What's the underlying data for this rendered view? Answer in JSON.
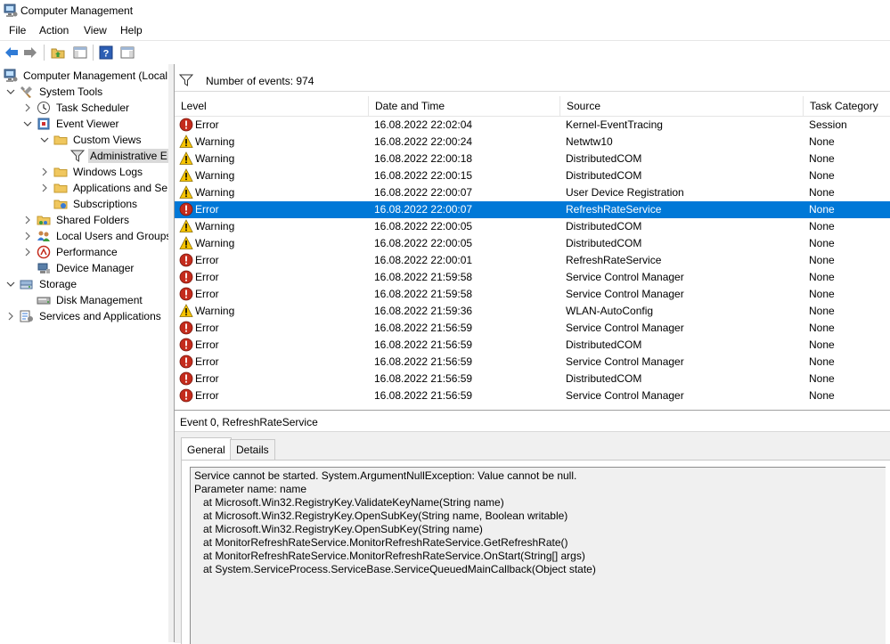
{
  "window": {
    "title": "Computer Management"
  },
  "menu": [
    "File",
    "Action",
    "View",
    "Help"
  ],
  "toolbar": [
    {
      "icon": "back-arrow-icon"
    },
    {
      "icon": "forward-arrow-icon"
    },
    {
      "icon": "up-folder-icon"
    },
    {
      "icon": "show-hide-console-tree-icon"
    },
    {
      "icon": "help-icon"
    },
    {
      "icon": "show-hide-action-pane-icon"
    }
  ],
  "tree": [
    {
      "label": "Computer Management (Local",
      "icon": "computer-management-icon",
      "exp": "none"
    },
    {
      "label": "System Tools",
      "icon": "system-tools-icon",
      "exp": "open"
    },
    {
      "label": "Task Scheduler",
      "icon": "clock-icon",
      "exp": "closed"
    },
    {
      "label": "Event Viewer",
      "icon": "event-viewer-icon",
      "exp": "open"
    },
    {
      "label": "Custom Views",
      "icon": "folder-icon",
      "exp": "open"
    },
    {
      "label": "Administrative E",
      "icon": "filter-icon",
      "exp": "none",
      "selected": true
    },
    {
      "label": "Windows Logs",
      "icon": "folder-icon",
      "exp": "closed"
    },
    {
      "label": "Applications and Se",
      "icon": "folder-icon",
      "exp": "closed"
    },
    {
      "label": "Subscriptions",
      "icon": "subscriptions-icon",
      "exp": "none"
    },
    {
      "label": "Shared Folders",
      "icon": "shared-folder-icon",
      "exp": "closed"
    },
    {
      "label": "Local Users and Groups",
      "icon": "users-icon",
      "exp": "closed"
    },
    {
      "label": "Performance",
      "icon": "performance-icon",
      "exp": "closed"
    },
    {
      "label": "Device Manager",
      "icon": "device-manager-icon",
      "exp": "none"
    },
    {
      "label": "Storage",
      "icon": "storage-icon",
      "exp": "open"
    },
    {
      "label": "Disk Management",
      "icon": "disk-icon",
      "exp": "none"
    },
    {
      "label": "Services and Applications",
      "icon": "services-icon",
      "exp": "closed"
    }
  ],
  "events": {
    "count_text": "Number of events: 974",
    "columns": [
      "Level",
      "Date and Time",
      "Source",
      "Task Category"
    ],
    "rows": [
      {
        "level": "Error",
        "datetime": "16.08.2022 22:02:04",
        "source": "Kernel-EventTracing",
        "category": "Session"
      },
      {
        "level": "Warning",
        "datetime": "16.08.2022 22:00:24",
        "source": "Netwtw10",
        "category": "None"
      },
      {
        "level": "Warning",
        "datetime": "16.08.2022 22:00:18",
        "source": "DistributedCOM",
        "category": "None"
      },
      {
        "level": "Warning",
        "datetime": "16.08.2022 22:00:15",
        "source": "DistributedCOM",
        "category": "None"
      },
      {
        "level": "Warning",
        "datetime": "16.08.2022 22:00:07",
        "source": "User Device Registration",
        "category": "None"
      },
      {
        "level": "Error",
        "datetime": "16.08.2022 22:00:07",
        "source": "RefreshRateService",
        "category": "None",
        "selected": true
      },
      {
        "level": "Warning",
        "datetime": "16.08.2022 22:00:05",
        "source": "DistributedCOM",
        "category": "None"
      },
      {
        "level": "Warning",
        "datetime": "16.08.2022 22:00:05",
        "source": "DistributedCOM",
        "category": "None"
      },
      {
        "level": "Error",
        "datetime": "16.08.2022 22:00:01",
        "source": "RefreshRateService",
        "category": "None"
      },
      {
        "level": "Error",
        "datetime": "16.08.2022 21:59:58",
        "source": "Service Control Manager",
        "category": "None"
      },
      {
        "level": "Error",
        "datetime": "16.08.2022 21:59:58",
        "source": "Service Control Manager",
        "category": "None"
      },
      {
        "level": "Warning",
        "datetime": "16.08.2022 21:59:36",
        "source": "WLAN-AutoConfig",
        "category": "None"
      },
      {
        "level": "Error",
        "datetime": "16.08.2022 21:56:59",
        "source": "Service Control Manager",
        "category": "None"
      },
      {
        "level": "Error",
        "datetime": "16.08.2022 21:56:59",
        "source": "DistributedCOM",
        "category": "None"
      },
      {
        "level": "Error",
        "datetime": "16.08.2022 21:56:59",
        "source": "Service Control Manager",
        "category": "None"
      },
      {
        "level": "Error",
        "datetime": "16.08.2022 21:56:59",
        "source": "DistributedCOM",
        "category": "None"
      },
      {
        "level": "Error",
        "datetime": "16.08.2022 21:56:59",
        "source": "Service Control Manager",
        "category": "None"
      }
    ]
  },
  "detail": {
    "header": "Event 0, RefreshRateService",
    "tabs": [
      "General",
      "Details"
    ],
    "active_tab": "General",
    "description": [
      "Service cannot be started. System.ArgumentNullException: Value cannot be null.",
      "Parameter name: name",
      "   at Microsoft.Win32.RegistryKey.ValidateKeyName(String name)",
      "   at Microsoft.Win32.RegistryKey.OpenSubKey(String name, Boolean writable)",
      "   at Microsoft.Win32.RegistryKey.OpenSubKey(String name)",
      "   at MonitorRefreshRateService.MonitorRefreshRateService.GetRefreshRate()",
      "   at MonitorRefreshRateService.MonitorRefreshRateService.OnStart(String[] args)",
      "   at System.ServiceProcess.ServiceBase.ServiceQueuedMainCallback(Object state)"
    ]
  },
  "colors": {
    "selection": "#0078d7",
    "error": "#c42b1c",
    "warning": "#f7c400"
  }
}
